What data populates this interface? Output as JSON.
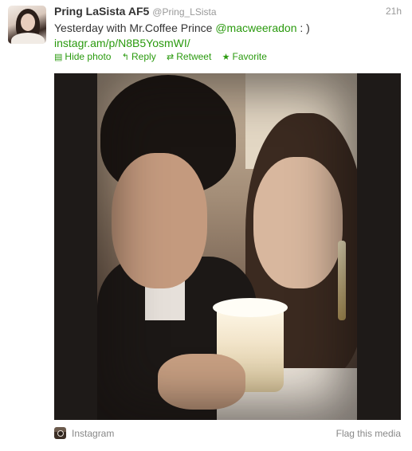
{
  "tweet": {
    "fullname": "Pring LaSista AF5",
    "username": "@Pring_LSista",
    "time": "21h",
    "text_prefix": "Yesterday with Mr.Coffee Prince ",
    "mention": "@macweeradon",
    "text_suffix": " : )",
    "link": "instagr.am/p/N8B5YosmWI/"
  },
  "actions": [
    {
      "icon": "media-icon",
      "glyph": "▤",
      "label": "Hide photo"
    },
    {
      "icon": "reply-icon",
      "glyph": "↰",
      "label": "Reply"
    },
    {
      "icon": "retweet-icon",
      "glyph": "⇄",
      "label": "Retweet"
    },
    {
      "icon": "star-icon",
      "glyph": "★",
      "label": "Favorite"
    }
  ],
  "footer": {
    "source": "Instagram",
    "flag": "Flag this media"
  },
  "colors": {
    "link": "#2a9a0e",
    "muted": "#999999"
  }
}
